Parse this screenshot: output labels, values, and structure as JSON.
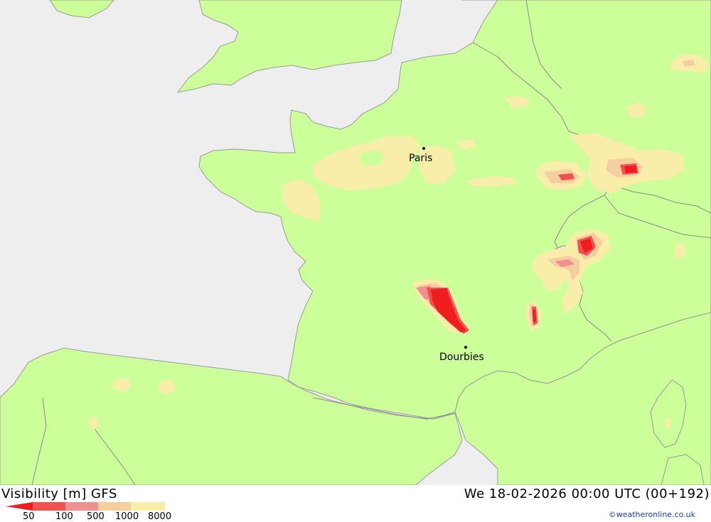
{
  "map": {
    "colors": {
      "sea": "#eeeeee",
      "land": "#ccff99",
      "border": "#9a9a9a",
      "vis_8000": "#f8eeaa",
      "vis_1000": "#f5cfa0",
      "vis_500": "#f09090",
      "vis_100": "#f05050",
      "vis_50": "#ee1e1e"
    },
    "cities": [
      {
        "name": "Paris"
      },
      {
        "name": "Dourbies"
      }
    ]
  },
  "footer": {
    "title_left": "Visibility [m] GFS",
    "title_right": "We 18-02-2026 00:00 UTC (00+192)",
    "legend": {
      "labels": [
        "50",
        "100",
        "500",
        "1000",
        "8000"
      ],
      "colors": [
        "#ee1e1e",
        "#f05050",
        "#f09090",
        "#f5cfa0",
        "#f8eeaa"
      ]
    },
    "credit": "©weatheronline.co.uk"
  }
}
